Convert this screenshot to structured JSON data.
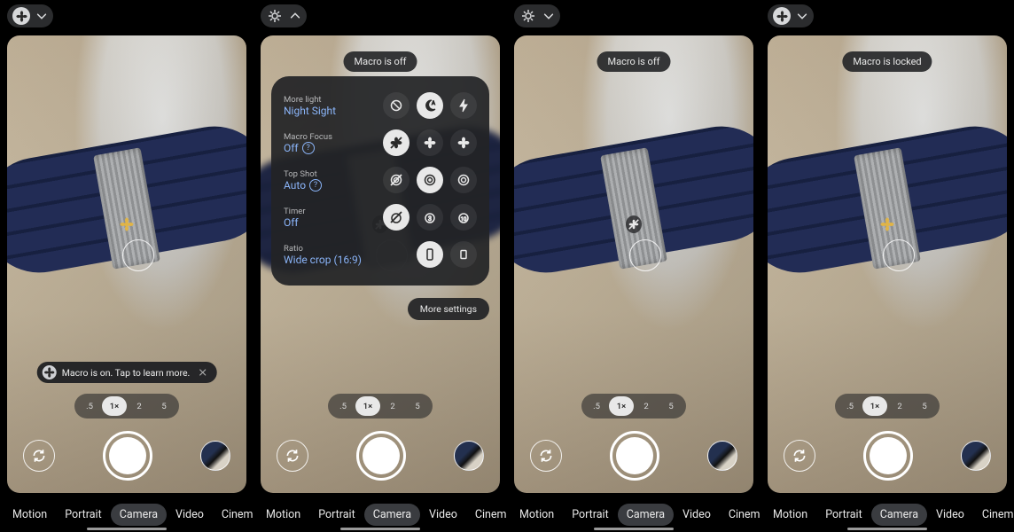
{
  "phones": [
    {
      "top_icon": "macro-flower",
      "chevron": "down",
      "toast": null,
      "tip": "Macro is on. Tap to learn more.",
      "flower_overlay": "gold",
      "focus_ring": true
    },
    {
      "top_icon": "settings-gear",
      "chevron": "up",
      "toast": "Macro is off",
      "tip": null,
      "flower_overlay": "off-slash",
      "focus_ring": true,
      "settings_open": true
    },
    {
      "top_icon": "settings-gear",
      "chevron": "down",
      "toast": "Macro is off",
      "tip": null,
      "flower_overlay": "off-slash",
      "focus_ring": true
    },
    {
      "top_icon": "macro-flower",
      "chevron": "down",
      "toast": "Macro is locked",
      "tip": null,
      "flower_overlay": "gold",
      "focus_ring": true
    }
  ],
  "zoom": {
    "options": [
      ".5",
      "1×",
      "2",
      "5"
    ],
    "active_index": 1
  },
  "modes": {
    "items": [
      "Motion",
      "Portrait",
      "Camera",
      "Video",
      "Cinema"
    ],
    "active_index": 2
  },
  "settings_panel": {
    "rows": [
      {
        "title": "More light",
        "value": "Night Sight",
        "help": false,
        "options": [
          "ban",
          "night-auto",
          "flash"
        ],
        "active": 1
      },
      {
        "title": "Macro Focus",
        "value": "Off",
        "help": true,
        "options": [
          "flower-off",
          "flower-auto",
          "flower-on"
        ],
        "active": 0
      },
      {
        "title": "Top Shot",
        "value": "Auto",
        "help": true,
        "options": [
          "topshot-off",
          "topshot-auto",
          "topshot-on"
        ],
        "active": 1
      },
      {
        "title": "Timer",
        "value": "Off",
        "help": false,
        "options": [
          "timer-off",
          "timer-3",
          "timer-10"
        ],
        "active": 0
      },
      {
        "title": "Ratio",
        "value": "Wide crop (16:9)",
        "help": false,
        "options": [
          "ratio-full",
          "ratio-wide"
        ],
        "active": 0
      }
    ],
    "more": "More settings"
  },
  "colors": {
    "accent_blue": "#8ab4f8",
    "panel": "rgba(34,35,38,0.93)",
    "gold": "#e0b447"
  }
}
